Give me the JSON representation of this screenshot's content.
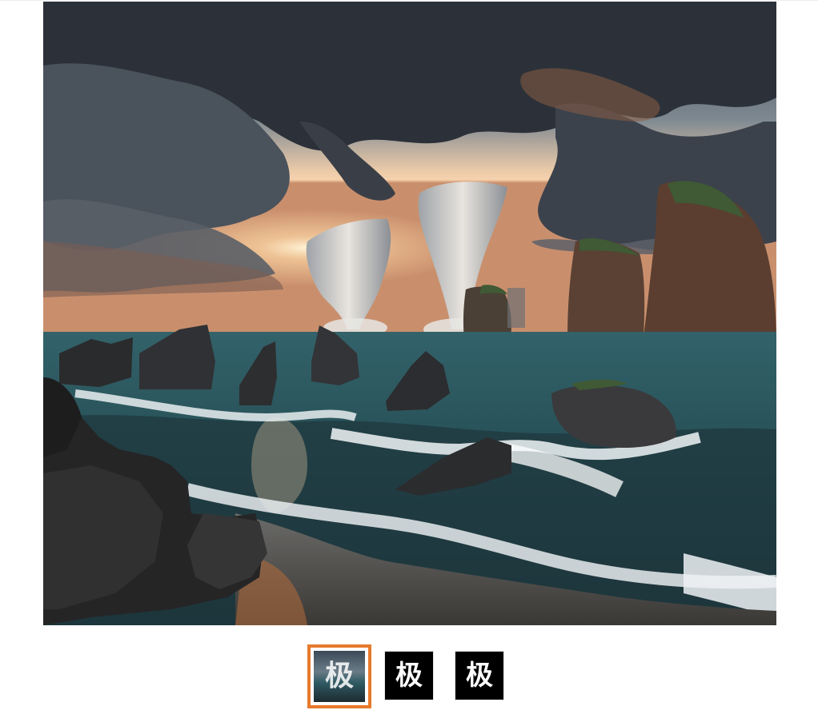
{
  "gallery": {
    "main_image_alt": "",
    "selected_index": 0,
    "accent_color": "#e77a2c",
    "thumbnails": [
      {
        "label": "极",
        "selected": true
      },
      {
        "label": "极",
        "selected": false
      },
      {
        "label": "极",
        "selected": false
      }
    ]
  }
}
